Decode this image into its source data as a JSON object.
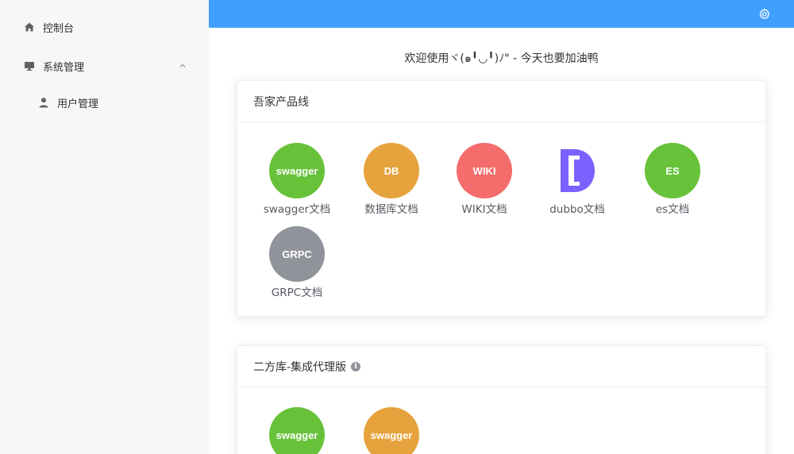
{
  "sidebar": {
    "items": [
      {
        "label": "控制台",
        "icon": "home-icon"
      },
      {
        "label": "系统管理",
        "icon": "monitor-icon",
        "expanded": true
      },
      {
        "label": "用户管理",
        "icon": "user-icon"
      }
    ]
  },
  "header": {
    "settings_icon": "gear-icon",
    "color": "#409eff"
  },
  "main": {
    "welcome": "欢迎使用ヾ(๑╹◡╹)ﾉ\" - 今天也要加油鸭",
    "cards": [
      {
        "title": "吾家产品线",
        "tools": [
          {
            "badge": "swagger",
            "label": "swagger文档",
            "color": "#67c23a"
          },
          {
            "badge": "DB",
            "label": "数据库文档",
            "color": "#e6a23c"
          },
          {
            "badge": "WIKI",
            "label": "WIKI文档",
            "color": "#f56c6c"
          },
          {
            "badge": "",
            "label": "dubbo文档",
            "color": "#7b61ff"
          },
          {
            "badge": "ES",
            "label": "es文档",
            "color": "#67c23a"
          },
          {
            "badge": "GRPC",
            "label": "GRPC文档",
            "color": "#909399"
          }
        ]
      },
      {
        "title": "二方库-集成代理版",
        "info": "i",
        "tools": [
          {
            "badge": "swagger",
            "label": "",
            "color": "#67c23a"
          },
          {
            "badge": "swagger",
            "label": "",
            "color": "#e6a23c"
          }
        ]
      }
    ]
  }
}
